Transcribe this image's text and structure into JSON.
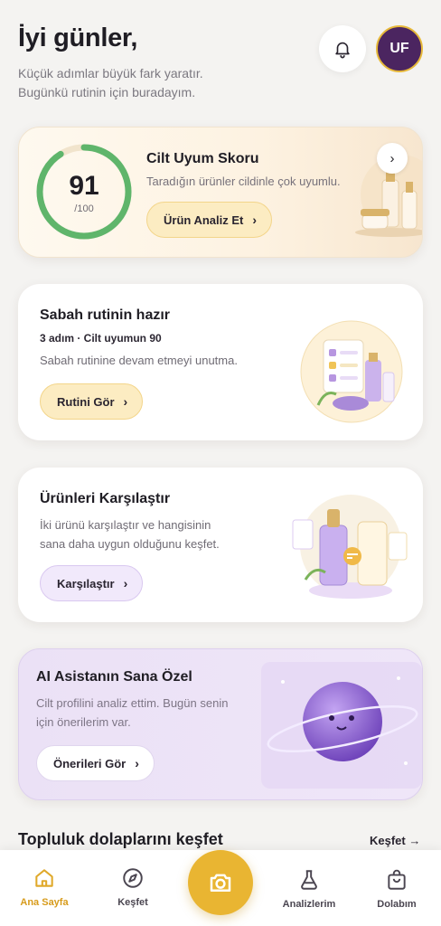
{
  "header": {
    "greeting": "İyi günler,",
    "subtitle_line1": "Küçük adımlar büyük fark yaratır.",
    "subtitle_line2": "Bugünkü rutinin için buradayım.",
    "avatar_initials": "UF"
  },
  "score_card": {
    "score": "91",
    "score_max": "/100",
    "score_fraction": 0.91,
    "title": "Cilt Uyum Skoru",
    "description": "Taradığın ürünler cildinle çok uyumlu.",
    "button_label": "Ürün Analiz Et",
    "ring_color": "#5fb56b"
  },
  "routine_card": {
    "title": "Sabah rutinin hazır",
    "meta": "3 adım · Cilt uyumun 90",
    "description": "Sabah rutinine devam etmeyi unutma.",
    "button_label": "Rutini Gör"
  },
  "compare_card": {
    "title": "Ürünleri Karşılaştır",
    "description_line1": "İki ürünü karşılaştır ve hangisinin",
    "description_line2": "sana daha uygun olduğunu keşfet.",
    "button_label": "Karşılaştır"
  },
  "ai_card": {
    "title": "AI Asistanın Sana Özel",
    "description_line1": "Cilt profilini analiz ettim. Bugün senin",
    "description_line2": "için önerilerim var.",
    "button_label": "Önerileri Gör"
  },
  "community": {
    "title": "Topluluk dolaplarını keşfet",
    "link_label": "Keşfet →"
  },
  "bottom_nav": {
    "items": [
      {
        "label": "Ana Sayfa",
        "icon": "home-icon",
        "active": true
      },
      {
        "label": "Keşfet",
        "icon": "compass-icon",
        "active": false
      },
      {
        "label": "Analizlerim",
        "icon": "flask-icon",
        "active": false
      },
      {
        "label": "Dolabım",
        "icon": "bag-icon",
        "active": false
      }
    ],
    "camera_icon": "camera-icon"
  },
  "colors": {
    "accent_gold": "#e9b532",
    "brand_purple": "#4b2560",
    "lavender": "#efe6f8"
  }
}
